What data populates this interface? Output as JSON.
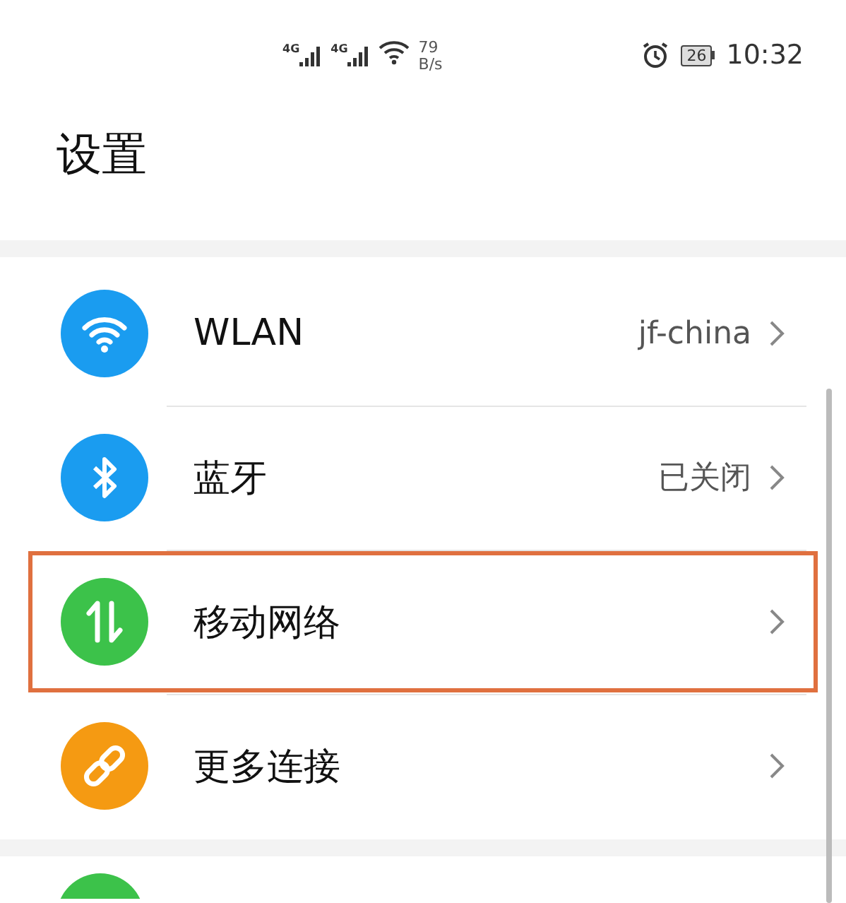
{
  "status_bar": {
    "signals": [
      {
        "network": "4G"
      },
      {
        "network": "4G"
      }
    ],
    "speed_value": "79",
    "speed_unit": "B/s",
    "battery": "26",
    "time": "10:32"
  },
  "title": "设置",
  "items": [
    {
      "kind": "wifi",
      "label": "WLAN",
      "value": "jf-china",
      "highlighted": false
    },
    {
      "kind": "bluetooth",
      "label": "蓝牙",
      "value": "已关闭",
      "highlighted": false
    },
    {
      "kind": "mobile",
      "label": "移动网络",
      "highlighted": true
    },
    {
      "kind": "link",
      "label": "更多连接",
      "highlighted": false
    }
  ]
}
